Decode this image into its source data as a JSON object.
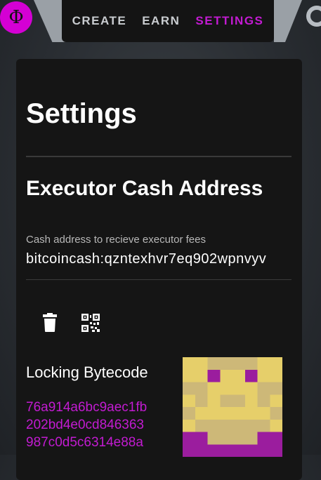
{
  "nav": {
    "logo_symbol": "Φ",
    "items": [
      {
        "label": "CREATE",
        "active": false
      },
      {
        "label": "EARN",
        "active": false
      },
      {
        "label": "SETTINGS",
        "active": true
      }
    ]
  },
  "page": {
    "title": "Settings",
    "section_title": "Executor Cash Address"
  },
  "cash_address": {
    "label": "Cash address to recieve executor fees",
    "value": "bitcoincash:qzntexhvr7eq902wpnvyv"
  },
  "actions": {
    "delete_icon": "trash-icon",
    "qr_icon": "qr-code-icon"
  },
  "bytecode": {
    "label": "Locking Bytecode",
    "lines": [
      "76a914a6bc9aec1fb",
      "202bd4e0cd846363",
      "987c0d5c6314e88a"
    ]
  },
  "colors": {
    "accent": "#c21bd1",
    "card_bg": "#151515",
    "avatar_yellow": "#e6cf6a",
    "avatar_tan": "#cdb878",
    "avatar_purple": "#9b1d9e"
  }
}
